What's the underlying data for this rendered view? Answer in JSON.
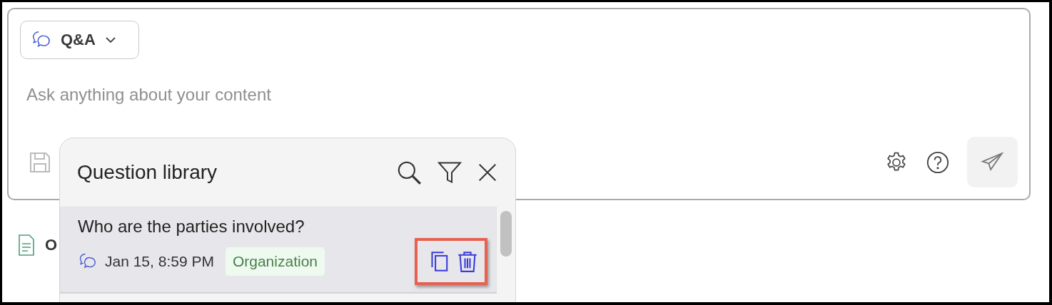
{
  "mode_selector": {
    "label": "Q&A"
  },
  "prompt": {
    "placeholder": "Ask anything about your content"
  },
  "recent_item": {
    "label": "O"
  },
  "question_library": {
    "title": "Question library",
    "questions": [
      {
        "text": "Who are the parties involved?",
        "date": "Jan 15, 8:59 PM",
        "tag": "Organization",
        "selected": true
      }
    ]
  }
}
